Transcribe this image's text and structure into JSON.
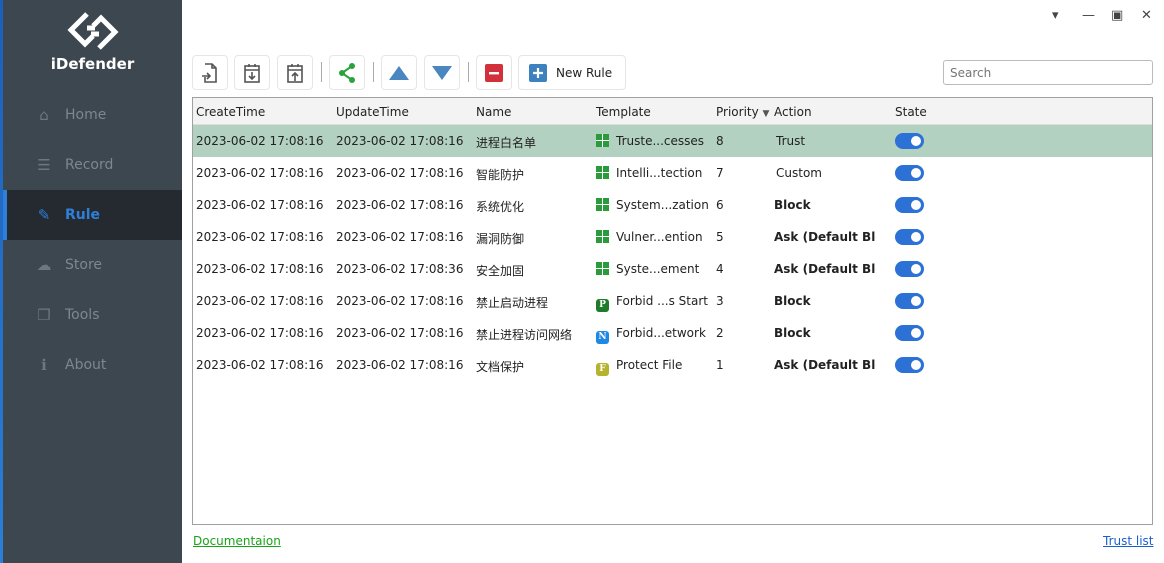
{
  "app": {
    "name": "iDefender"
  },
  "sidebar": {
    "items": [
      {
        "label": "Home",
        "icon": "home-icon"
      },
      {
        "label": "Record",
        "icon": "list-icon"
      },
      {
        "label": "Rule",
        "icon": "edit-icon",
        "active": true
      },
      {
        "label": "Store",
        "icon": "cloud-icon"
      },
      {
        "label": "Tools",
        "icon": "cubes-icon"
      },
      {
        "label": "About",
        "icon": "info-icon"
      }
    ]
  },
  "toolbar": {
    "new_rule": "New Rule",
    "search_placeholder": "Search"
  },
  "table": {
    "columns": [
      "CreateTime",
      "UpdateTime",
      "Name",
      "Template",
      "Priority",
      "Action",
      "State"
    ],
    "sort": {
      "column": "Priority",
      "direction": "descending"
    },
    "rows": [
      {
        "create": "2023-06-02 17:08:16",
        "update": "2023-06-02 17:08:16",
        "name": "进程白名单",
        "template": "Truste...cesses",
        "ticon": "grid",
        "priority": "8",
        "action": "Trust",
        "bold": false,
        "state": true,
        "selected": true
      },
      {
        "create": "2023-06-02 17:08:16",
        "update": "2023-06-02 17:08:16",
        "name": "智能防护",
        "template": "Intelli...tection",
        "ticon": "grid",
        "priority": "7",
        "action": "Custom",
        "bold": false,
        "state": true
      },
      {
        "create": "2023-06-02 17:08:16",
        "update": "2023-06-02 17:08:16",
        "name": "系统优化",
        "template": "System...zation",
        "ticon": "grid",
        "priority": "6",
        "action": "Block",
        "bold": true,
        "state": true
      },
      {
        "create": "2023-06-02 17:08:16",
        "update": "2023-06-02 17:08:16",
        "name": "漏洞防御",
        "template": "Vulner...ention",
        "ticon": "grid",
        "priority": "5",
        "action": "Ask (Default Blo",
        "bold": true,
        "state": true
      },
      {
        "create": "2023-06-02 17:08:16",
        "update": "2023-06-02 17:08:36",
        "name": "安全加固",
        "template": "Syste...ement",
        "ticon": "grid",
        "priority": "4",
        "action": "Ask (Default Blo",
        "bold": true,
        "state": true
      },
      {
        "create": "2023-06-02 17:08:16",
        "update": "2023-06-02 17:08:16",
        "name": "禁止启动进程",
        "template": "Forbid ...s Start",
        "ticon": "P",
        "tcolor": "#1f7a2a",
        "priority": "3",
        "action": "Block",
        "bold": true,
        "state": true
      },
      {
        "create": "2023-06-02 17:08:16",
        "update": "2023-06-02 17:08:16",
        "name": "禁止进程访问网络",
        "template": "Forbid...etwork",
        "ticon": "N",
        "tcolor": "#1e88e5",
        "priority": "2",
        "action": "Block",
        "bold": true,
        "state": true
      },
      {
        "create": "2023-06-02 17:08:16",
        "update": "2023-06-02 17:08:16",
        "name": "文档保护",
        "template": "Protect File",
        "ticon": "F",
        "tcolor": "#b5b32e",
        "priority": "1",
        "action": "Ask (Default Blo",
        "bold": true,
        "state": true
      }
    ]
  },
  "footer": {
    "doc_link": "Documentaion",
    "trust_link": "Trust list"
  },
  "colors": {
    "accent": "#2f7fd8",
    "selected_row": "#b3d1c1",
    "sidebar": "#3c4750"
  }
}
